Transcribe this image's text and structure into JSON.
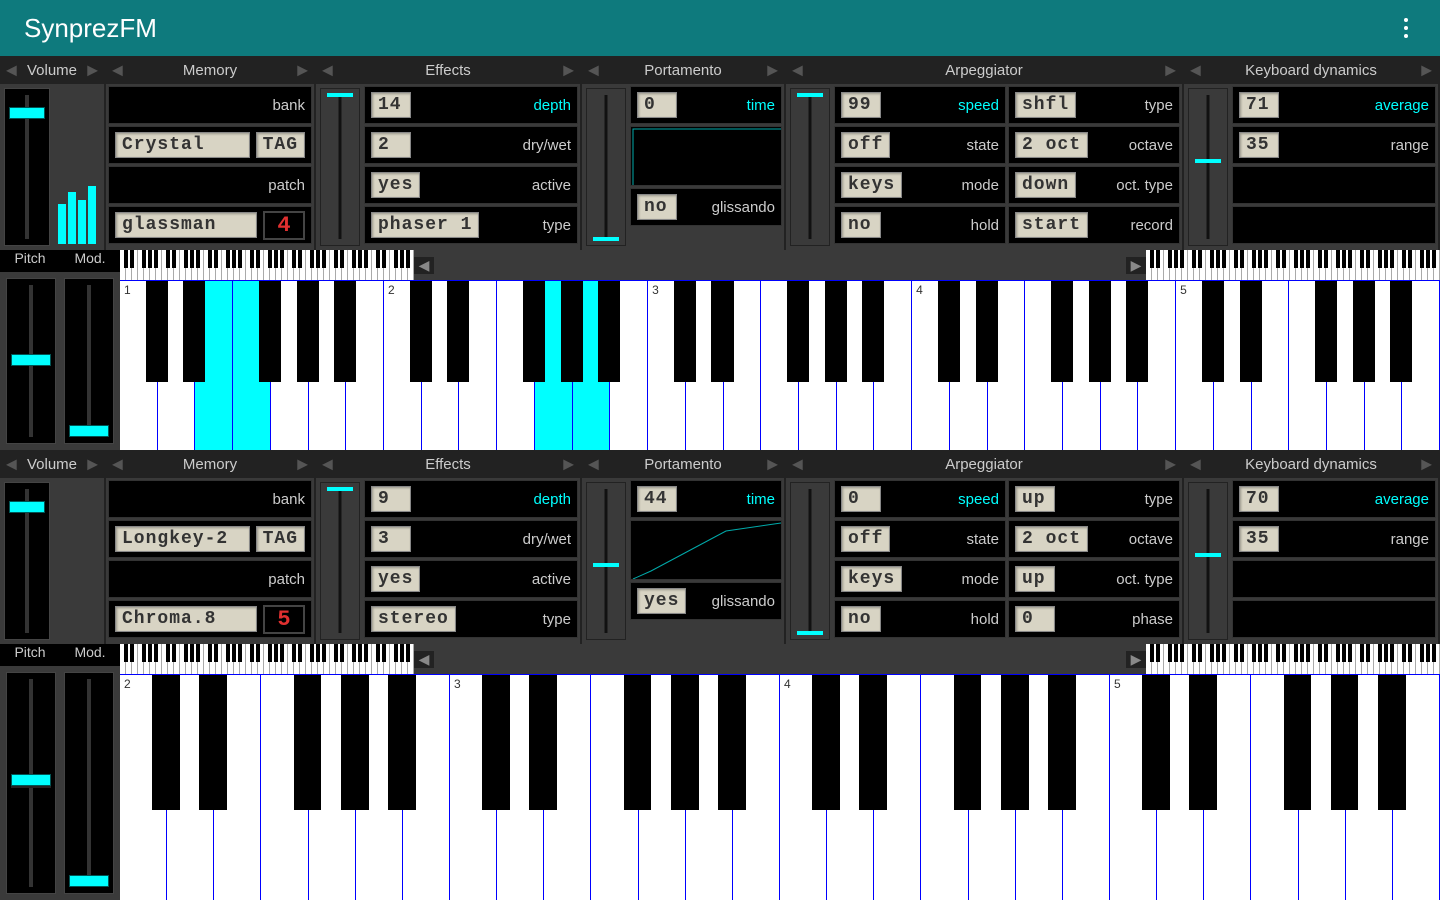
{
  "app": {
    "title": "SynprezFM"
  },
  "sections": {
    "volume": "Volume",
    "memory": "Memory",
    "effects": "Effects",
    "portamento": "Portamento",
    "arpeggiator": "Arpeggiator",
    "kbddyn": "Keyboard dynamics",
    "pitch": "Pitch",
    "mod": "Mod."
  },
  "labels": {
    "bank": "bank",
    "patch": "patch",
    "depth": "depth",
    "drywet": "dry/wet",
    "active": "active",
    "type": "type",
    "time": "time",
    "glissando": "glissando",
    "speed": "speed",
    "state": "state",
    "mode": "mode",
    "hold": "hold",
    "octave": "octave",
    "octtype": "oct. type",
    "record": "record",
    "phase": "phase",
    "average": "average",
    "range": "range",
    "tag": "TAG"
  },
  "top": {
    "memory": {
      "bank_name": "Crystal",
      "patch_name": "glassman",
      "patch_num": "4"
    },
    "effects": {
      "depth": "14",
      "drywet": "2",
      "active": "yes",
      "type": "phaser 1"
    },
    "portamento": {
      "time": "0",
      "glissando": "no"
    },
    "arp": {
      "speed": "99",
      "state": "off",
      "mode": "keys",
      "hold": "no",
      "type": "shfl",
      "octave": "2 oct",
      "octtype": "down",
      "record": "start"
    },
    "kbd": {
      "average": "71",
      "range": "35"
    },
    "keyboard": {
      "octaves": [
        "1",
        "2",
        "3",
        "4",
        "5"
      ],
      "pressed": [
        2,
        3,
        11,
        12
      ]
    }
  },
  "bottom": {
    "memory": {
      "bank_name": "Longkey-2",
      "patch_name": "Chroma.8",
      "patch_num": "5"
    },
    "effects": {
      "depth": "9",
      "drywet": "3",
      "active": "yes",
      "type": "stereo"
    },
    "portamento": {
      "time": "44",
      "glissando": "yes"
    },
    "arp": {
      "speed": "0",
      "state": "off",
      "mode": "keys",
      "hold": "no",
      "type": "up",
      "octave": "2 oct",
      "octtype": "up",
      "phase": "0"
    },
    "kbd": {
      "average": "70",
      "range": "35"
    },
    "keyboard": {
      "octaves": [
        "2",
        "3",
        "4",
        "5"
      ],
      "pressed": []
    }
  }
}
